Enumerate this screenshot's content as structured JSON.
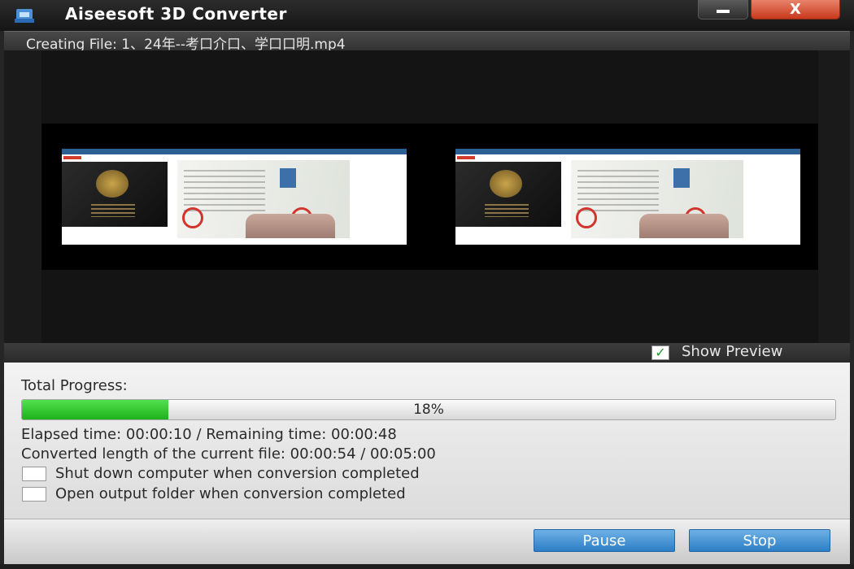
{
  "window": {
    "title": "Aiseesoft 3D Converter",
    "minimize_icon": "minimize-icon",
    "close_icon": "close-icon",
    "close_glyph": "X"
  },
  "status": {
    "creating_label": "Creating File: 1、24年--考口介口、学口口明.mp4"
  },
  "preview": {
    "show_preview_label": "Show Preview",
    "show_preview_checked": true,
    "check_glyph": "✓"
  },
  "progress": {
    "title": "Total Progress:",
    "percent_text": "18%",
    "percent_value": 18,
    "accent_color": "#1db21a",
    "elapsed_line": "Elapsed time: 00:00:10 / Remaining time: 00:00:48",
    "converted_line": "Converted length of the current file: 00:00:54 / 00:05:00"
  },
  "options": {
    "shutdown_label": "Shut down computer when conversion completed",
    "shutdown_checked": false,
    "open_folder_label": "Open output folder when conversion completed",
    "open_folder_checked": false
  },
  "buttons": {
    "pause_label": "Pause",
    "stop_label": "Stop",
    "button_color": "#2c7ec5"
  }
}
